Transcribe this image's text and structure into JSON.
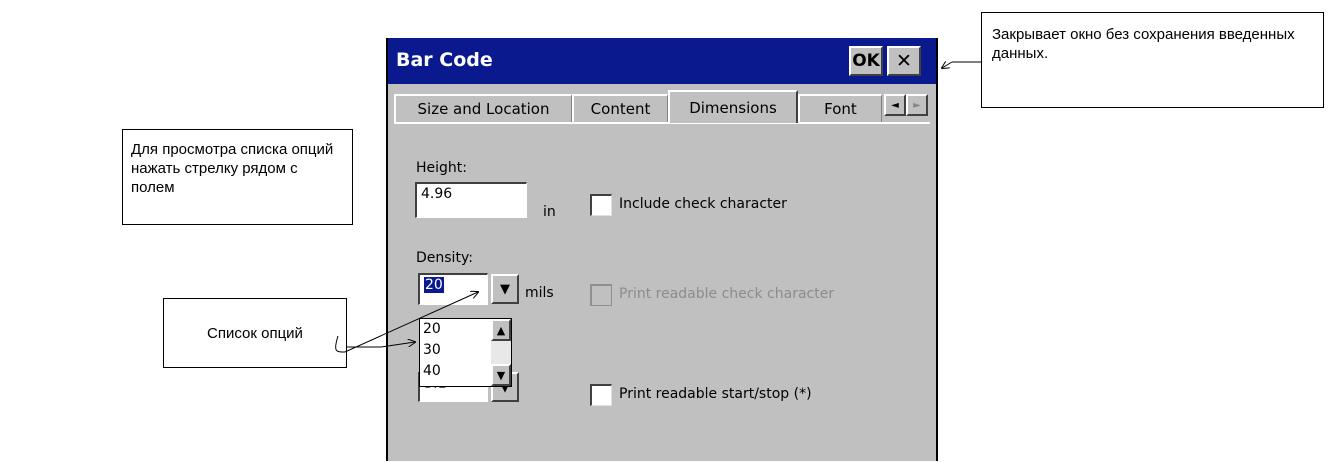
{
  "dialog": {
    "title": "Bar Code",
    "ok_label": "OK",
    "close_glyph": "✕",
    "tabs": [
      {
        "label": "Size and Location"
      },
      {
        "label": "Content"
      },
      {
        "label": "Dimensions",
        "active": true
      },
      {
        "label": "Font"
      }
    ],
    "tab_scroll_left": "◄",
    "tab_scroll_right": "►",
    "height_label": "Height:",
    "height_value": "4.96",
    "height_unit": "in",
    "include_check_label": "Include check character",
    "density_label": "Density:",
    "density_value": "20",
    "density_unit": "mils",
    "dropdown_glyph": "▼",
    "print_check_label": "Print readable check character",
    "density_options": [
      "20",
      "30",
      "40"
    ],
    "hidden_field_value": "3:1",
    "scroll_up_glyph": "▲",
    "scroll_down_glyph": "▼",
    "print_startstop_label": "Print readable start/stop (*)"
  },
  "callouts": {
    "close_note": "Закрывает окно без сохранения введенных данных.",
    "arrow_note": "Для просмотра списка опций нажать стрелку рядом с полем",
    "list_note": "Список опций"
  },
  "colors": {
    "titlebar": "#0a1a8e",
    "dialog_bg": "#c0c0c0",
    "selection": "#0a1a8e"
  }
}
